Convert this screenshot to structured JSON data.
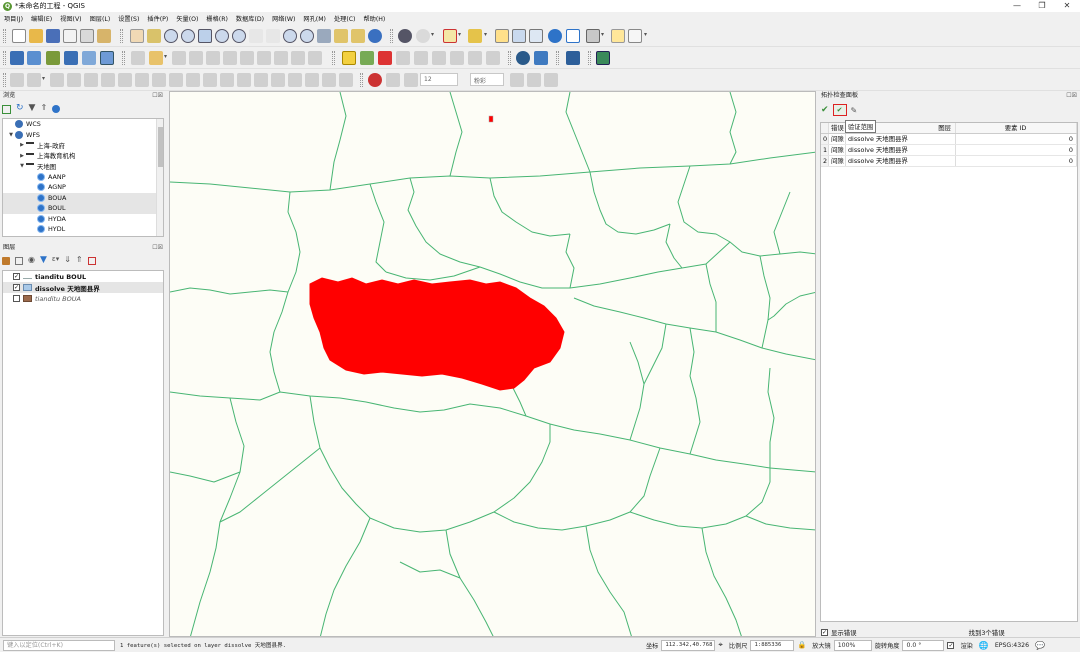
{
  "window": {
    "title": "*未命名的工程 - QGIS",
    "logo": "Q",
    "minimize": "—",
    "maximize": "❐",
    "close": "✕"
  },
  "menu": [
    "项目(J)",
    "编辑(E)",
    "视图(V)",
    "图层(L)",
    "设置(S)",
    "插件(P)",
    "矢量(O)",
    "栅格(R)",
    "数据库(D)",
    "网络(W)",
    "网孔(M)",
    "处理(C)",
    "帮助(H)"
  ],
  "toolbar3": {
    "font_size_value": "12",
    "font_combo": "粉彩"
  },
  "browser": {
    "title": "浏览",
    "buttons": "☐☒",
    "items": [
      {
        "label": "WCS",
        "indent": 0,
        "arrow": "",
        "icon": "globe"
      },
      {
        "label": "WFS",
        "indent": 0,
        "arrow": "▼",
        "icon": "globe"
      },
      {
        "label": "上海-政府",
        "indent": 1,
        "arrow": "▶",
        "icon": "folder"
      },
      {
        "label": "上海教育机构",
        "indent": 1,
        "arrow": "▶",
        "icon": "folder"
      },
      {
        "label": "天地图",
        "indent": 1,
        "arrow": "▼",
        "icon": "folder"
      },
      {
        "label": "AANP",
        "indent": 2,
        "arrow": "",
        "icon": "wfs"
      },
      {
        "label": "AGNP",
        "indent": 2,
        "arrow": "",
        "icon": "wfs"
      },
      {
        "label": "BOUA",
        "indent": 2,
        "arrow": "",
        "icon": "wfs",
        "highlight": true
      },
      {
        "label": "BOUL",
        "indent": 2,
        "arrow": "",
        "icon": "wfs",
        "highlight": true
      },
      {
        "label": "HYDA",
        "indent": 2,
        "arrow": "",
        "icon": "wfs"
      },
      {
        "label": "HYDL",
        "indent": 2,
        "arrow": "",
        "icon": "wfs"
      }
    ]
  },
  "layers": {
    "title": "图层",
    "buttons": "☐☒",
    "items": [
      {
        "label": "tianditu BOUL",
        "checked": true,
        "bold": true,
        "italic": false,
        "symbol": "line"
      },
      {
        "label": "dissolve 天地图县界",
        "checked": true,
        "bold": true,
        "italic": false,
        "symbol": "poly_blue",
        "selected": true
      },
      {
        "label": "tianditu BOUA",
        "checked": false,
        "bold": false,
        "italic": true,
        "symbol": "poly_brown"
      }
    ]
  },
  "map": {
    "boundary_color": "#48b573",
    "selection_color": "#ff0000",
    "background": "#fdfdf6"
  },
  "topology": {
    "title": "拓扑检查面板",
    "tooltip": "验证范围",
    "buttons": "☐☒",
    "columns": [
      "错误",
      "图层",
      "要素 ID"
    ],
    "rows": [
      {
        "idx": "0",
        "error": "间隙",
        "layer": "dissolve 天地图县界",
        "fid": "0"
      },
      {
        "idx": "1",
        "error": "间隙",
        "layer": "dissolve 天地图县界",
        "fid": "0"
      },
      {
        "idx": "2",
        "error": "间隙",
        "layer": "dissolve 天地图县界",
        "fid": "0"
      }
    ],
    "show_errors_label": "显示错误",
    "found_label": "找到3个错误",
    "show_errors_checked": true
  },
  "status": {
    "locator_placeholder": "键入以定位(Ctrl+K)",
    "message": "1 feature(s) selected on layer dissolve 天地图县界.",
    "coord_label": "坐标",
    "coord_value": "112.342,40.768",
    "scale_label": "比例尺",
    "scale_value": "1:885336",
    "magnifier_label": "放大镜",
    "magnifier_value": "100%",
    "rotation_label": "旋转角度",
    "rotation_value": "0.0 °",
    "render_label": "渲染",
    "crs": "EPSG:4326"
  }
}
